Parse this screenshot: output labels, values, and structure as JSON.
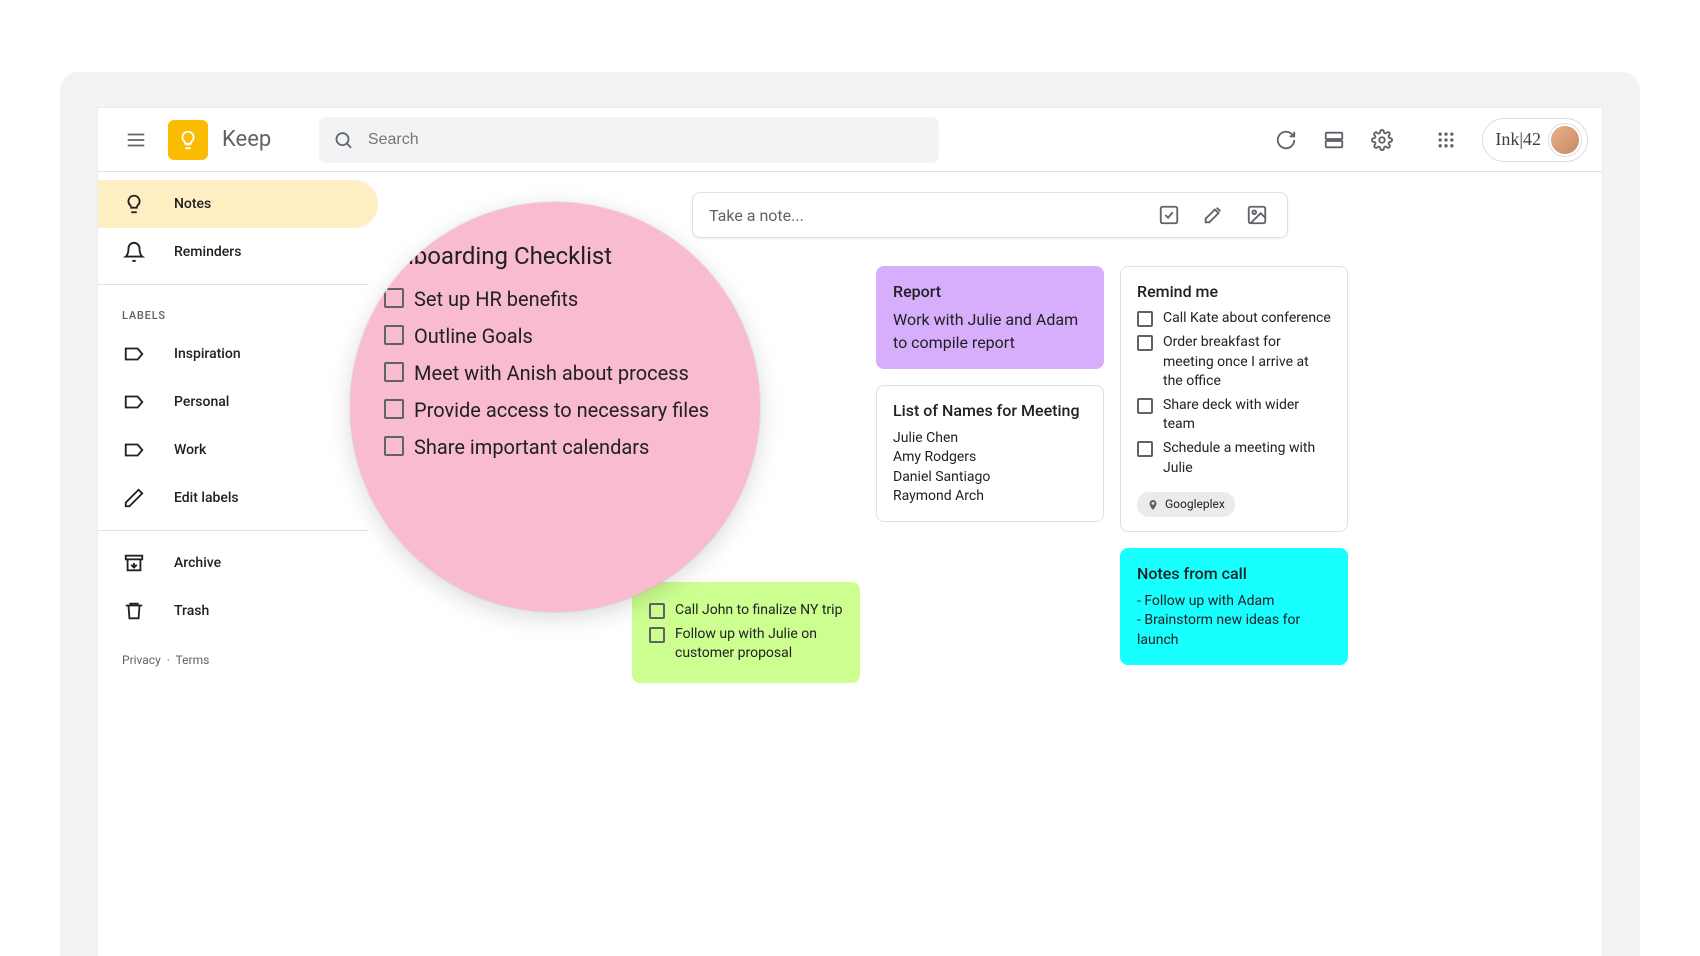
{
  "header": {
    "app_title": "Keep",
    "search_placeholder": "Search",
    "user_brand": "Ink|42"
  },
  "sidebar": {
    "notes": "Notes",
    "reminders": "Reminders",
    "labels_header": "LABELS",
    "labels": [
      "Inspiration",
      "Personal",
      "Work"
    ],
    "edit_labels": "Edit labels",
    "archive": "Archive",
    "trash": "Trash",
    "privacy": "Privacy",
    "terms": "Terms",
    "dot": "·"
  },
  "newnote": {
    "placeholder": "Take a note..."
  },
  "magnifier": {
    "title": "Onboarding Checklist",
    "items": [
      "Set up HR benefits",
      "Outline Goals",
      "Meet with Anish about process",
      "Provide access to necessary files",
      "Share important calendars"
    ]
  },
  "col1": {
    "green": {
      "items": [
        "Call John to finalize NY trip",
        "Follow up with Julie on customer proposal"
      ]
    }
  },
  "col2": {
    "report": {
      "title": "Report",
      "body": "Work with Julie and Adam to compile report"
    },
    "names": {
      "title": "List of Names for Meeting",
      "people": [
        "Julie Chen",
        "Amy Rodgers",
        "Daniel Santiago",
        "Raymond Arch"
      ]
    }
  },
  "col3": {
    "remind": {
      "title": "Remind me",
      "items": [
        "Call Kate about conference",
        "Order breakfast for meeting once I arrive at the office",
        "Share deck with wider team",
        "Schedule a meeting with Julie"
      ],
      "location": "Googleplex"
    },
    "call": {
      "title": "Notes from call",
      "lines": [
        "- Follow up with Adam",
        "- Brainstorm new ideas for launch"
      ]
    }
  }
}
